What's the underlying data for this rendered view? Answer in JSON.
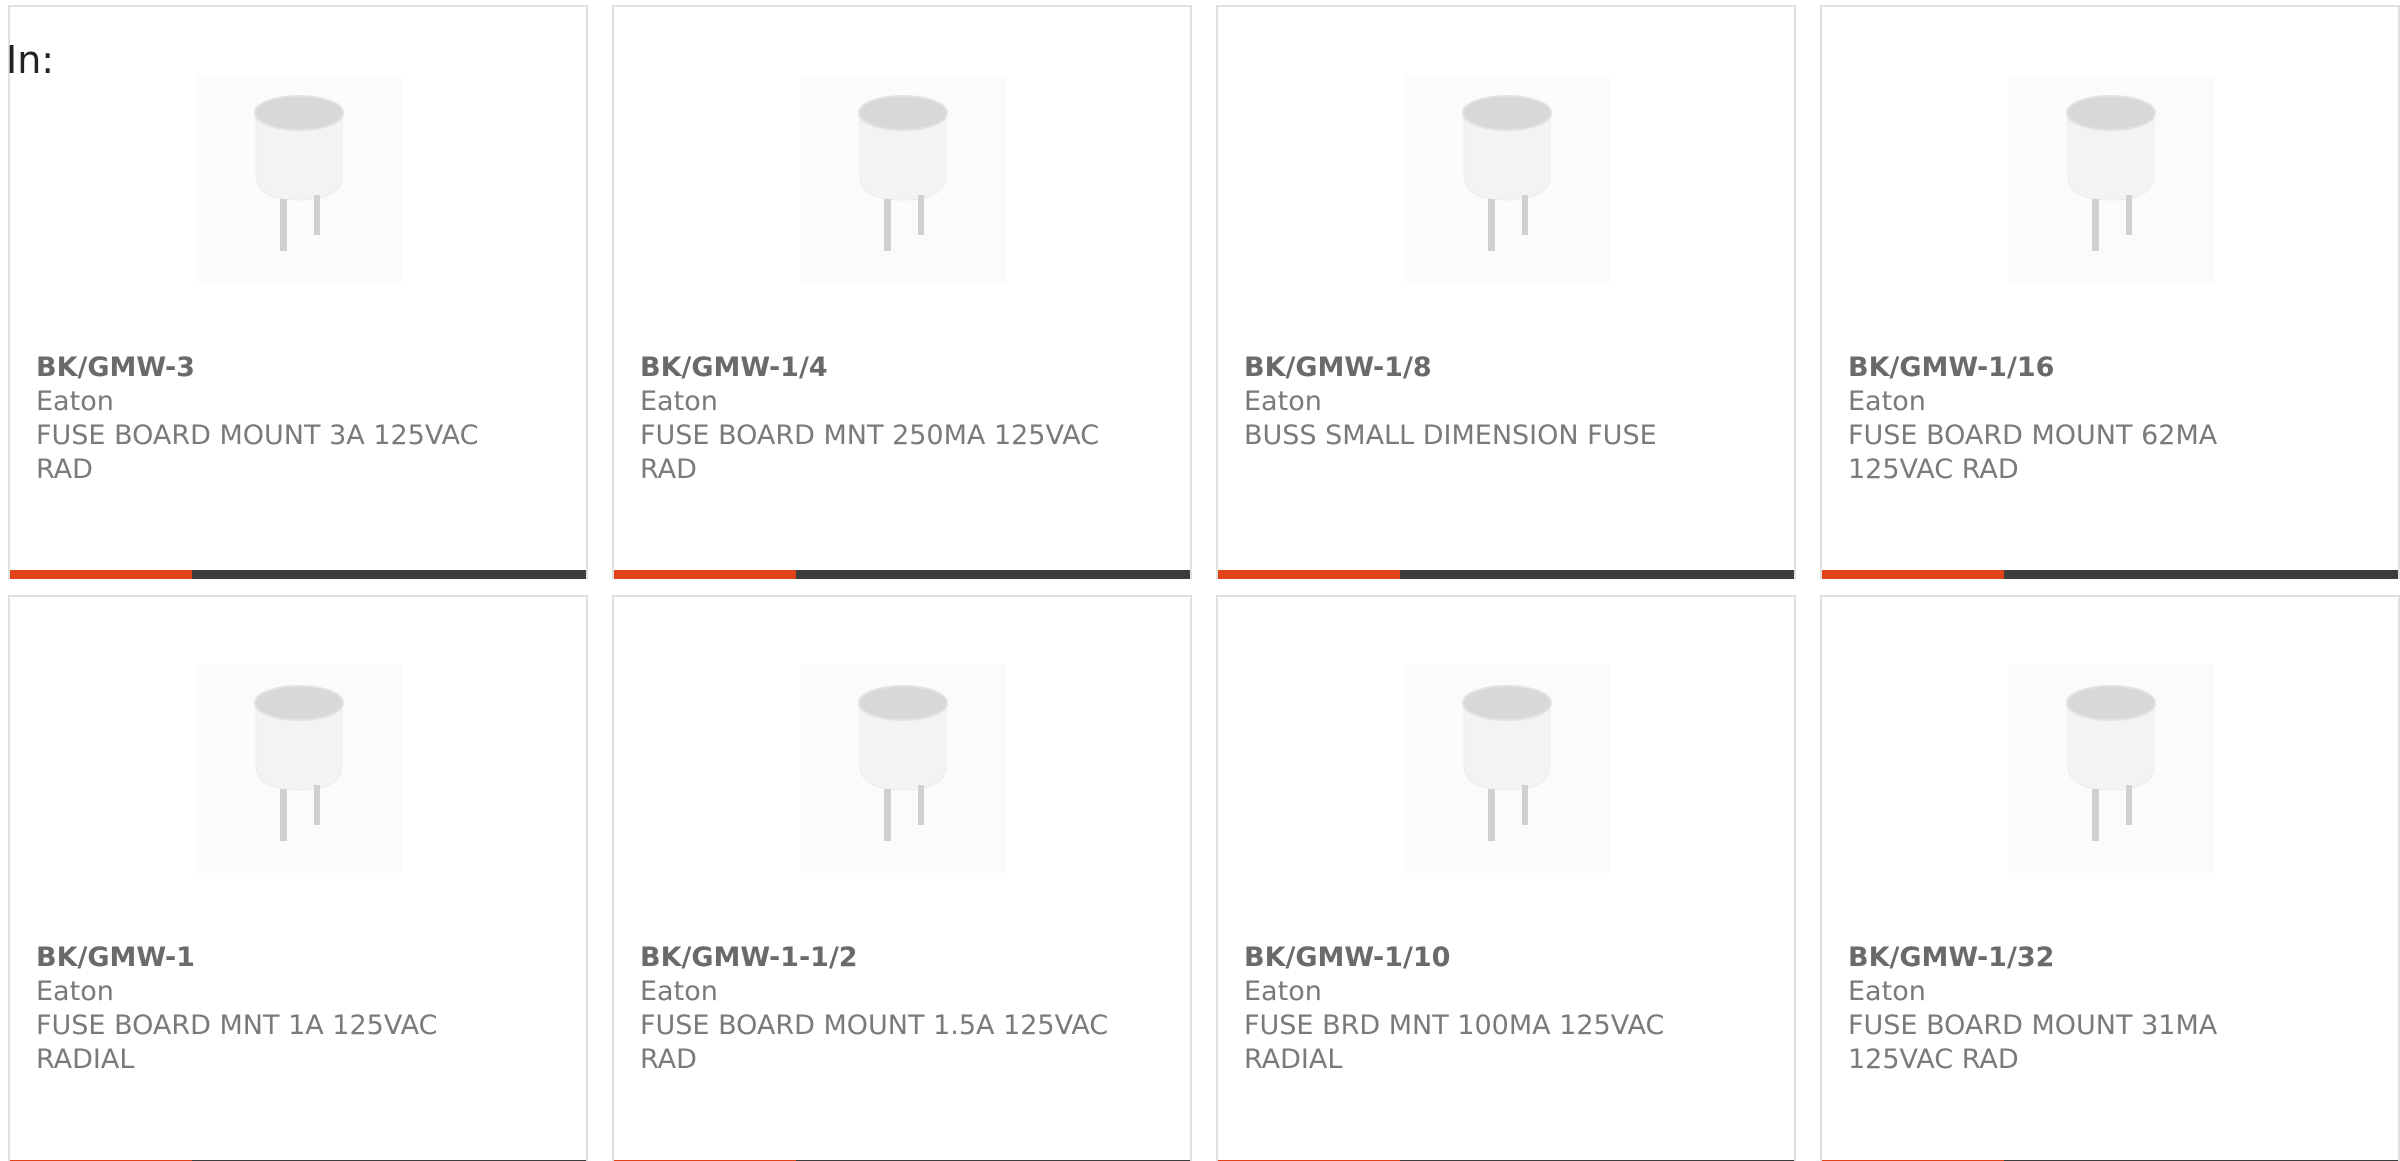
{
  "filter": {
    "label": "In:"
  },
  "colors": {
    "accent": "#e04418",
    "bar": "#3d3d3d",
    "card_border": "#e0e0e0",
    "text": "#707070"
  },
  "products": [
    {
      "part_number": "BK/GMW-3",
      "manufacturer": "Eaton",
      "description": "FUSE BOARD MOUNT 3A 125VAC RAD",
      "image": "fuse-image"
    },
    {
      "part_number": "BK/GMW-1/4",
      "manufacturer": "Eaton",
      "description": "FUSE BOARD MNT 250MA 125VAC RAD",
      "image": "fuse-image"
    },
    {
      "part_number": "BK/GMW-1/8",
      "manufacturer": "Eaton",
      "description": "BUSS SMALL DIMENSION FUSE",
      "image": "fuse-image"
    },
    {
      "part_number": "BK/GMW-1/16",
      "manufacturer": "Eaton",
      "description": "FUSE BOARD MOUNT 62MA 125VAC RAD",
      "image": "fuse-image"
    },
    {
      "part_number": "BK/GMW-1",
      "manufacturer": "Eaton",
      "description": "FUSE BOARD MNT 1A 125VAC RADIAL",
      "image": "fuse-image"
    },
    {
      "part_number": "BK/GMW-1-1/2",
      "manufacturer": "Eaton",
      "description": "FUSE BOARD MOUNT 1.5A 125VAC RAD",
      "image": "fuse-image"
    },
    {
      "part_number": "BK/GMW-1/10",
      "manufacturer": "Eaton",
      "description": "FUSE BRD MNT 100MA 125VAC RADIAL",
      "image": "fuse-image"
    },
    {
      "part_number": "BK/GMW-1/32",
      "manufacturer": "Eaton",
      "description": "FUSE BOARD MOUNT 31MA 125VAC RAD",
      "image": "fuse-image"
    }
  ]
}
